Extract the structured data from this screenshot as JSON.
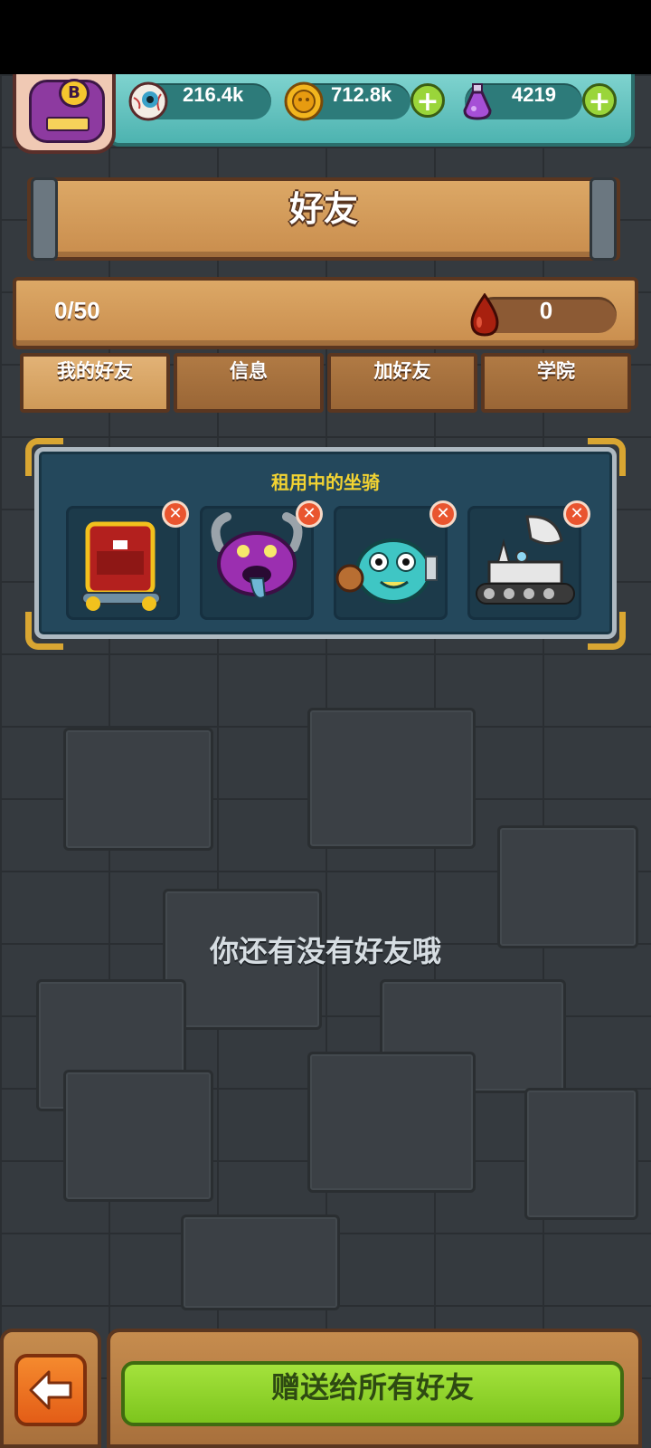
{
  "header": {
    "rank_letter": "B",
    "eyeballs": "216.4k",
    "coins": "712.8k",
    "potions": "4219"
  },
  "title": "好友",
  "info": {
    "friend_count": "0/50",
    "blood_value": "0"
  },
  "tabs": [
    {
      "label": "我的好友",
      "active": true
    },
    {
      "label": "信息",
      "active": false
    },
    {
      "label": "加好友",
      "active": false
    },
    {
      "label": "学院",
      "active": false
    }
  ],
  "rented_mounts": {
    "title": "租用中的坐骑",
    "remove_symbol": "✕"
  },
  "empty_message": "你还有没有好友哦",
  "bottom": {
    "gift_all_label": "赠送给所有好友"
  },
  "colors": {
    "accent_green": "#7dc51d",
    "panel_title_yellow": "#f2d332",
    "wood": "#c98d4d"
  }
}
